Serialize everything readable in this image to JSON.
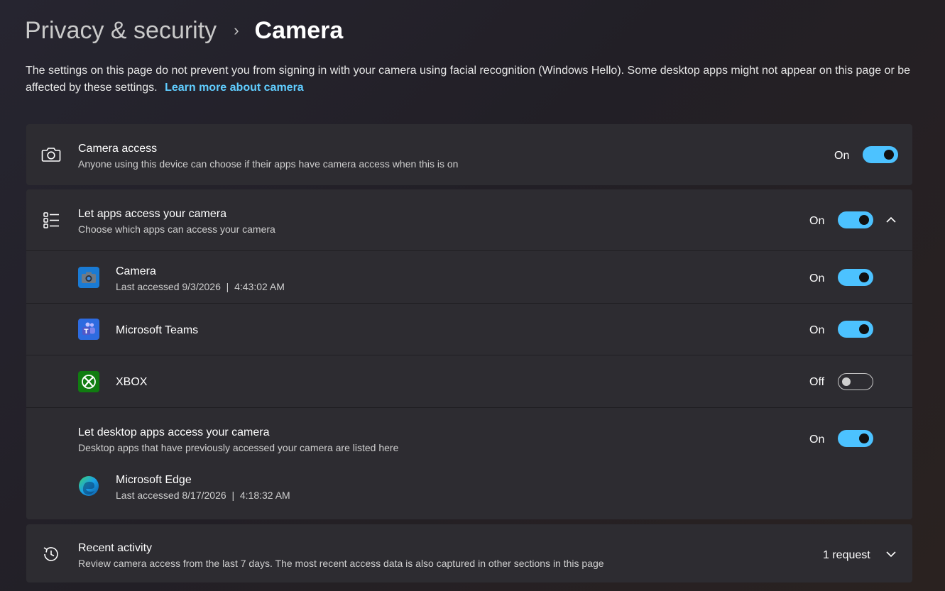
{
  "breadcrumb": {
    "parent": "Privacy & security",
    "separator": "›",
    "current": "Camera"
  },
  "description": {
    "text": "The settings on this page do not prevent you from signing in with your camera using facial recognition (Windows Hello). Some desktop apps might not appear on this page or be affected by these settings.",
    "link": "Learn more about camera"
  },
  "camera_access": {
    "title": "Camera access",
    "subtitle": "Anyone using this device can choose if their apps have camera access when this is on",
    "state": "On",
    "icon": "camera-icon"
  },
  "let_apps": {
    "title": "Let apps access your camera",
    "subtitle": "Choose which apps can access your camera",
    "state": "On",
    "icon": "list-icon"
  },
  "apps": [
    {
      "name": "Camera",
      "detail": "Last accessed 9/3/2026  |  4:43:02 AM",
      "state": "On",
      "icon": "camera-app-icon"
    },
    {
      "name": "Microsoft Teams",
      "detail": "",
      "state": "On",
      "icon": "teams-icon"
    },
    {
      "name": "XBOX",
      "detail": "",
      "state": "Off",
      "icon": "xbox-icon"
    }
  ],
  "desktop_apps": {
    "title": "Let desktop apps access your camera",
    "subtitle": "Desktop apps that have previously accessed your camera are listed here",
    "state": "On",
    "app": {
      "name": "Microsoft Edge",
      "detail": "Last accessed 8/17/2026  |  4:18:32 AM",
      "icon": "edge-icon"
    }
  },
  "recent_activity": {
    "title": "Recent activity",
    "subtitle": "Review camera access from the last 7 days. The most recent access data is also captured in other sections in this page",
    "count": "1 request",
    "icon": "history-icon"
  },
  "colors": {
    "accent": "#4cc2ff",
    "link": "#60cdff",
    "card": "#2d2c31"
  }
}
